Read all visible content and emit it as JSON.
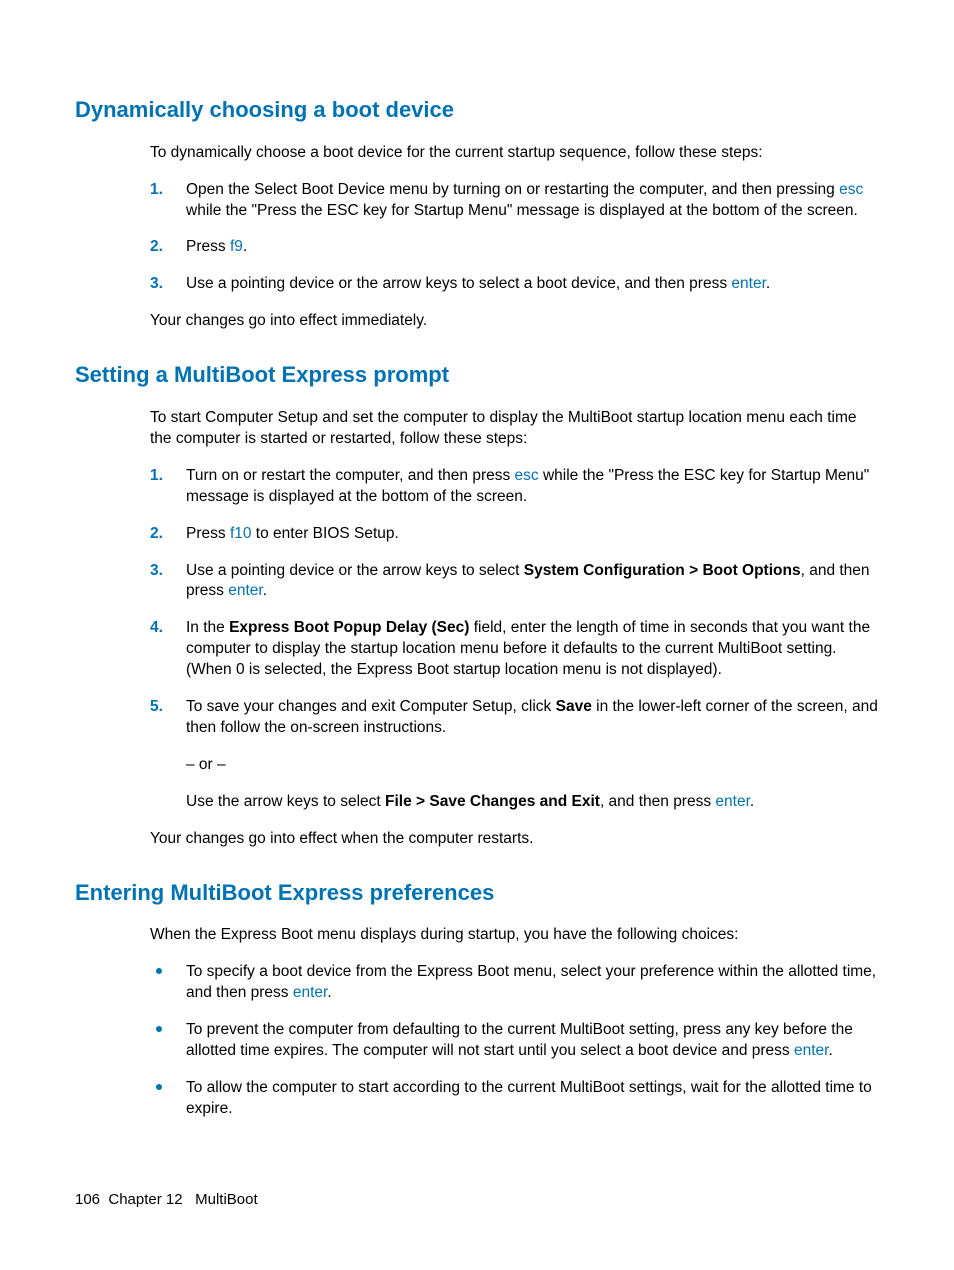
{
  "sections": {
    "s1": {
      "heading": "Dynamically choosing a boot device",
      "intro": "To dynamically choose a boot device for the current startup sequence, follow these steps:",
      "steps": {
        "n1": "1.",
        "t1a": "Open the Select Boot Device menu by turning on or restarting the computer, and then pressing ",
        "t1b": "esc",
        "t1c": " while the \"Press the ESC key for Startup Menu\" message is displayed at the bottom of the screen.",
        "n2": "2.",
        "t2a": "Press ",
        "t2b": "f9",
        "t2c": ".",
        "n3": "3.",
        "t3a": "Use a pointing device or the arrow keys to select a boot device, and then press ",
        "t3b": "enter",
        "t3c": "."
      },
      "outro": "Your changes go into effect immediately."
    },
    "s2": {
      "heading": "Setting a MultiBoot Express prompt",
      "intro": "To start Computer Setup and set the computer to display the MultiBoot startup location menu each time the computer is started or restarted, follow these steps:",
      "steps": {
        "n1": "1.",
        "t1a": "Turn on or restart the computer, and then press ",
        "t1b": "esc",
        "t1c": " while the \"Press the ESC key for Startup Menu\" message is displayed at the bottom of the screen.",
        "n2": "2.",
        "t2a": "Press ",
        "t2b": "f10",
        "t2c": " to enter BIOS Setup.",
        "n3": "3.",
        "t3a": "Use a pointing device or the arrow keys to select ",
        "t3b": "System Configuration > Boot Options",
        "t3c": ", and then press ",
        "t3d": "enter",
        "t3e": ".",
        "n4": "4.",
        "t4a": "In the ",
        "t4b": "Express Boot Popup Delay (Sec)",
        "t4c": " field, enter the length of time in seconds that you want the computer to display the startup location menu before it defaults to the current MultiBoot setting. (When 0 is selected, the Express Boot startup location menu is not displayed).",
        "n5": "5.",
        "t5a": "To save your changes and exit Computer Setup, click ",
        "t5b": "Save",
        "t5c": " in the lower-left corner of the screen, and then follow the on-screen instructions.",
        "t5or": "– or –",
        "t5d": "Use the arrow keys to select ",
        "t5e": "File > Save Changes and Exit",
        "t5f": ", and then press ",
        "t5g": "enter",
        "t5h": "."
      },
      "outro": "Your changes go into effect when the computer restarts."
    },
    "s3": {
      "heading": "Entering MultiBoot Express preferences",
      "intro": "When the Express Boot menu displays during startup, you have the following choices:",
      "bullets": {
        "b1a": "To specify a boot device from the Express Boot menu, select your preference within the allotted time, and then press ",
        "b1b": "enter",
        "b1c": ".",
        "b2a": "To prevent the computer from defaulting to the current MultiBoot setting, press any key before the allotted time expires. The computer will not start until you select a boot device and press ",
        "b2b": "enter",
        "b2c": ".",
        "b3": "To allow the computer to start according to the current MultiBoot settings, wait for the allotted time to expire."
      }
    }
  },
  "footer": {
    "page": "106",
    "chapter": "Chapter 12",
    "title": "MultiBoot"
  }
}
